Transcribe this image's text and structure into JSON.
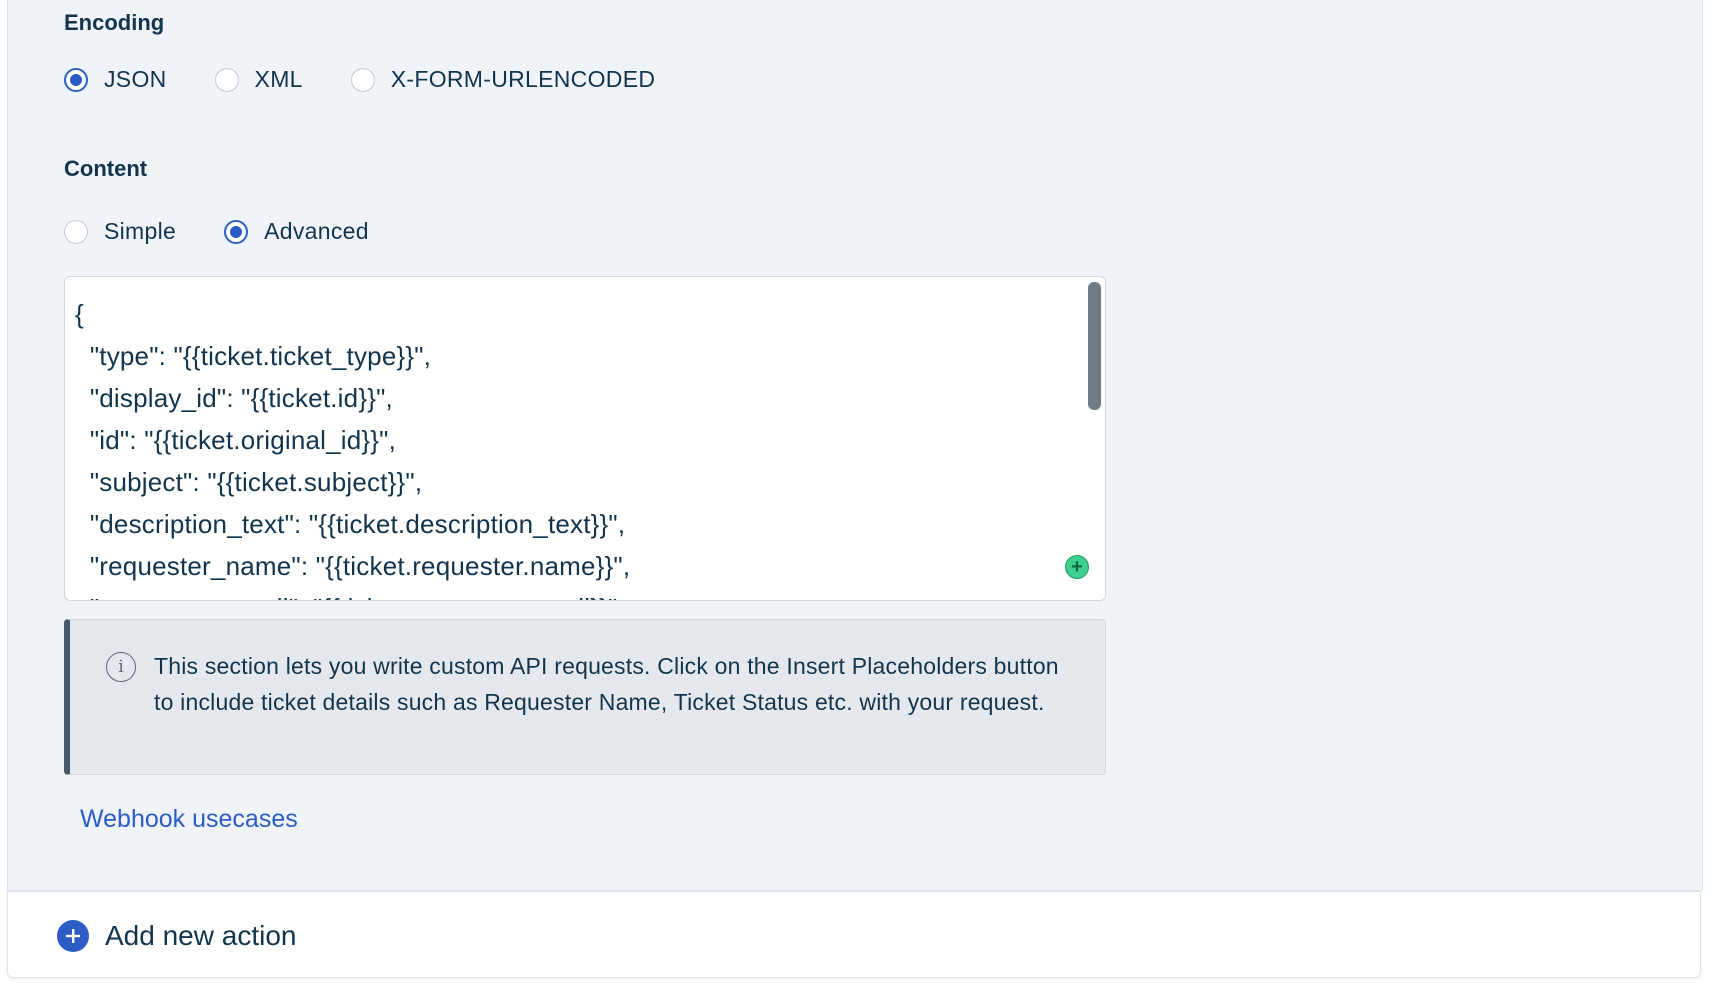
{
  "encoding": {
    "label": "Encoding",
    "options": [
      {
        "label": "JSON",
        "checked": true
      },
      {
        "label": "XML",
        "checked": false
      },
      {
        "label": "X-FORM-URLENCODED",
        "checked": false
      }
    ]
  },
  "content": {
    "label": "Content",
    "options": [
      {
        "label": "Simple",
        "checked": false
      },
      {
        "label": "Advanced",
        "checked": true
      }
    ]
  },
  "editor": {
    "lines": [
      "{",
      "  \"type\": \"{{ticket.ticket_type}}\",",
      "  \"display_id\": \"{{ticket.id}}\",",
      "  \"id\": \"{{ticket.original_id}}\",",
      "  \"subject\": \"{{ticket.subject}}\",",
      "  \"description_text\": \"{{ticket.description_text}}\",",
      "  \"requester_name\": \"{{ticket.requester.name}}\",",
      "  \"requester_email\": \"{{ticket.requester.email}}\","
    ],
    "insert_icon": "plus-circle-icon"
  },
  "info": {
    "icon": "info-icon",
    "text": "This section lets you write custom API requests. Click on the Insert Placeholders button to include ticket details such as Requester Name, Ticket Status etc. with your request."
  },
  "links": {
    "webhook_usecases": "Webhook usecases"
  },
  "footer": {
    "add_action_label": "Add new action",
    "add_icon": "plus-circle-icon"
  },
  "colors": {
    "accent": "#2c5cc5",
    "text": "#12344d",
    "panel_bg": "#f0f4f8",
    "success": "#3ecf8e"
  }
}
